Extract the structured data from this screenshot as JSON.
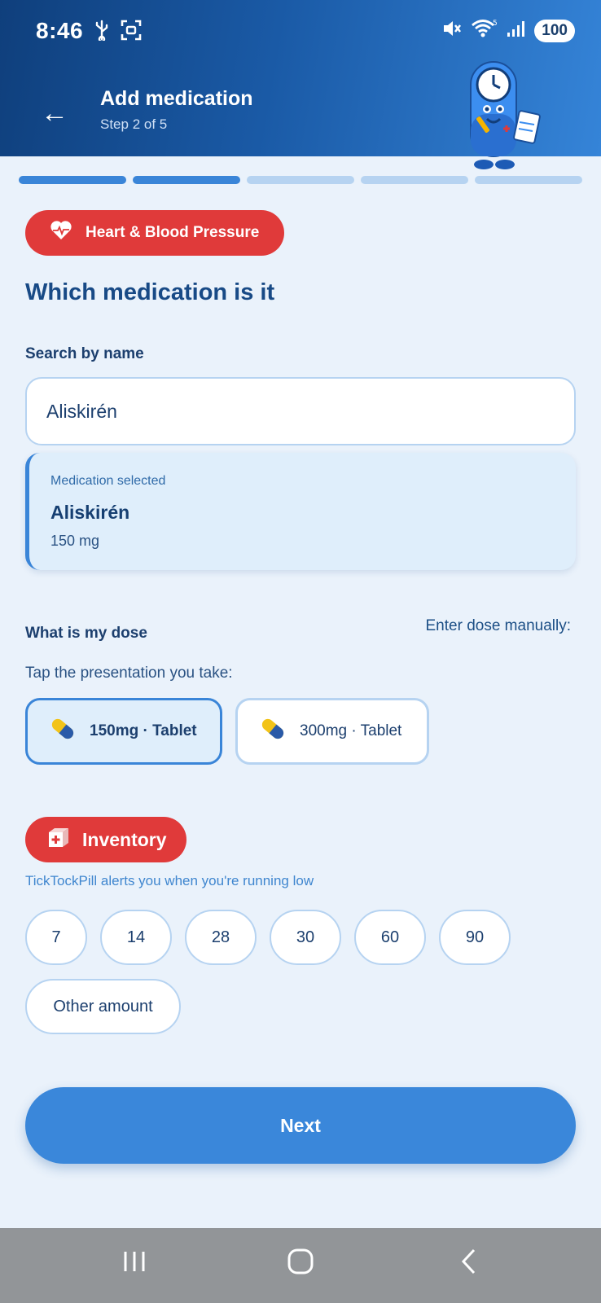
{
  "status_bar": {
    "time": "8:46",
    "battery": "100",
    "icons": [
      "usb-icon",
      "screenshot-icon",
      "mute-icon",
      "wifi-icon",
      "signal-icon"
    ]
  },
  "header": {
    "title": "Add medication",
    "subtitle": "Step 2 of 5",
    "back_icon": "←"
  },
  "progress": {
    "current_step": 2,
    "total_steps": 5
  },
  "category": {
    "label": "Heart & Blood Pressure",
    "icon": "heart-pulse-icon",
    "color": "#e03a3a"
  },
  "section": {
    "title": "Which medication is it",
    "search_label": "Search by name",
    "search_value": "Aliskirén"
  },
  "selected": {
    "caption": "Medication selected",
    "name": "Aliskirén",
    "dose": "150 mg"
  },
  "dose": {
    "title": "What is my dose",
    "manual_link": "Enter dose manually:",
    "hint": "Tap the presentation you take:",
    "options": [
      {
        "label": "150mg · Tablet",
        "selected": true,
        "icon": "capsule-icon"
      },
      {
        "label": "300mg · Tablet",
        "selected": false,
        "icon": "capsule-icon"
      }
    ]
  },
  "inventory": {
    "label": "Inventory",
    "icon": "medkit-icon",
    "hint": "TickTockPill alerts you when you're running low",
    "amounts": [
      "7",
      "14",
      "28",
      "30",
      "60",
      "90"
    ],
    "other": "Other amount"
  },
  "next_button": {
    "label": "Next"
  },
  "colors": {
    "accent": "#3a87da",
    "category_red": "#e03a3a",
    "header_dark": "#0f3f7c"
  }
}
